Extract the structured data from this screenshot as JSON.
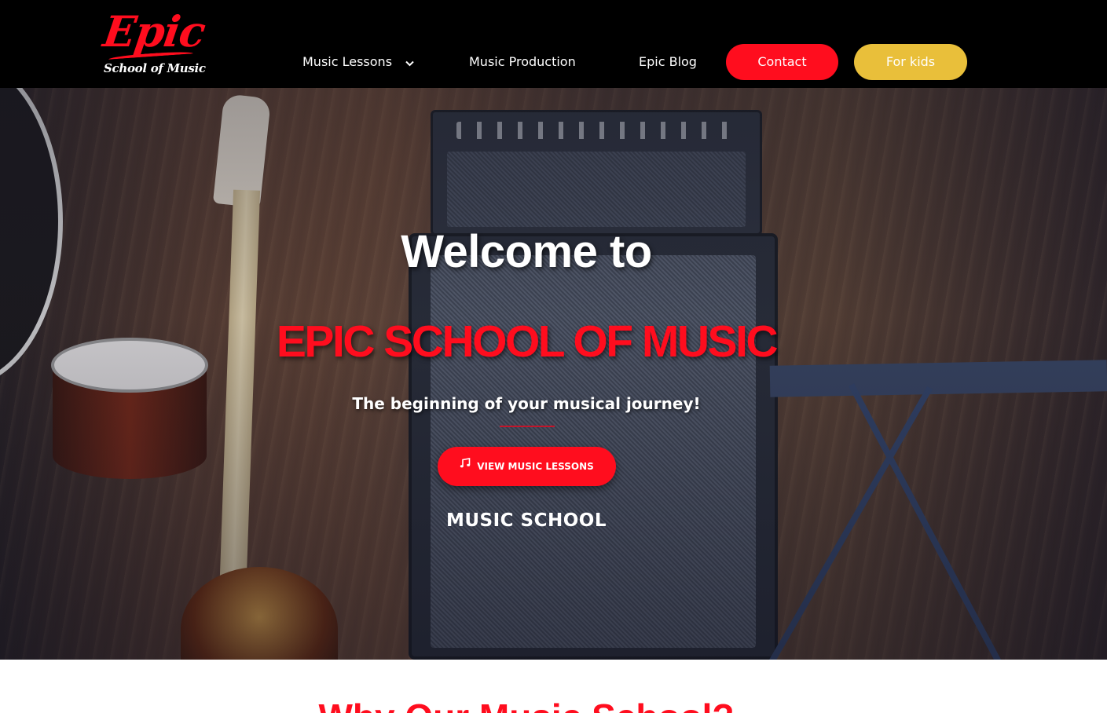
{
  "brand": {
    "logo_word": "Epic",
    "logo_sub": "School of Music",
    "accent": "#ff0d1e",
    "kids_color": "#e9bf3a"
  },
  "nav": {
    "lessons_label": "Music Lessons",
    "lessons_icon": "chevron-down-icon",
    "production_label": "Music Production",
    "blog_label": "Epic Blog",
    "contact_label": "Contact",
    "kids_label": "For kids"
  },
  "hero": {
    "title": "Welcome to",
    "name": "EPIC SCHOOL OF MUSIC",
    "tagline": "The beginning of your musical journey!",
    "cta_label": "VIEW MUSIC LESSONS",
    "cta_icon": "music-note-icon",
    "subtitle": "MUSIC SCHOOL"
  },
  "section": {
    "title": "Why Our Music School?"
  }
}
